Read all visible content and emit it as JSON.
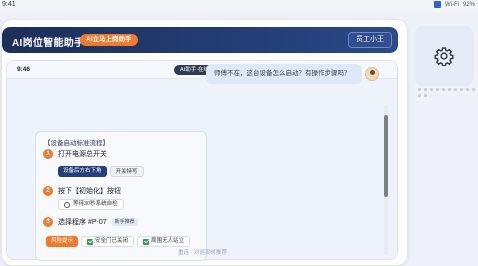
{
  "status_bar": {
    "time": "9:41",
    "wifi": "Wi-Fi",
    "battery": "92%"
  },
  "header": {
    "title": "AI岗位智能助手",
    "badge": "AI立马上岗助手",
    "user_button": "员工小王"
  },
  "phone": {
    "time": "9:46",
    "bot_status": "AI助手·在线"
  },
  "user_message": "师傅不在，这台设备怎么启动？有操作步骤吗？",
  "card": {
    "title": "【设备启动标准流程】",
    "steps": [
      {
        "num": "1",
        "text": "打开电源总开关"
      },
      {
        "num": "2",
        "text": "按下【初始化】按钮"
      },
      {
        "num": "3",
        "text": "选择程序 #P-07",
        "tag": "新手推荐"
      }
    ],
    "step1_chips": [
      "设备后方右下角",
      "开关特写"
    ],
    "step2_chip": "等待30秒系统自检",
    "step3_chips": [
      "风险提示",
      "安全门已关闭",
      "周围无人站立"
    ]
  },
  "footer": "重连 · 对话实时推荐",
  "colors": {
    "header_bg": "#1c2f5a",
    "accent_orange": "#f07a2a",
    "chip_dark": "#23407c",
    "check_green": "#2f9a4a"
  },
  "icons": [
    "gear-icon",
    "avatar",
    "check-icon",
    "clock-icon"
  ]
}
